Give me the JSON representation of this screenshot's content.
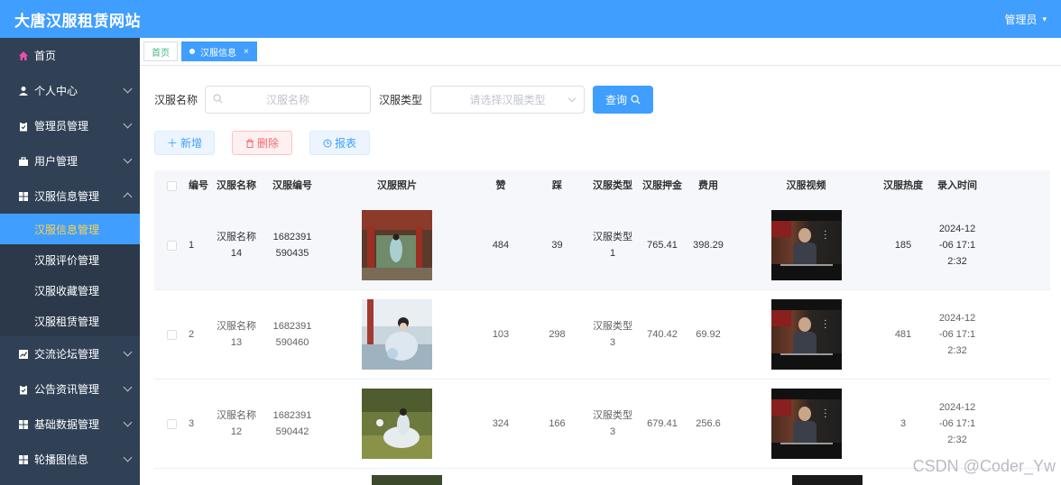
{
  "header": {
    "title": "大唐汉服租赁网站",
    "user_label": "管理员"
  },
  "sidebar": {
    "items": [
      {
        "label": "首页",
        "icon": "home-icon"
      },
      {
        "label": "个人中心",
        "icon": "user-icon"
      },
      {
        "label": "管理员管理",
        "icon": "clipboard-icon"
      },
      {
        "label": "用户管理",
        "icon": "briefcase-icon"
      },
      {
        "label": "汉服信息管理",
        "icon": "grid-icon"
      },
      {
        "label": "交流论坛管理",
        "icon": "chart-icon"
      },
      {
        "label": "公告资讯管理",
        "icon": "clipboard-icon"
      },
      {
        "label": "基础数据管理",
        "icon": "grid-icon"
      },
      {
        "label": "轮播图信息",
        "icon": "grid-icon"
      }
    ],
    "submenu": [
      {
        "label": "汉服信息管理",
        "active": true
      },
      {
        "label": "汉服评价管理"
      },
      {
        "label": "汉服收藏管理"
      },
      {
        "label": "汉服租赁管理"
      }
    ]
  },
  "tabs": [
    {
      "label": "首页"
    },
    {
      "label": "汉服信息",
      "close": "×"
    }
  ],
  "search": {
    "name_label": "汉服名称",
    "name_placeholder": "汉服名称",
    "type_label": "汉服类型",
    "type_placeholder": "请选择汉服类型",
    "query_button": "查询"
  },
  "actions": {
    "add": "新增",
    "delete": "删除",
    "report": "报表"
  },
  "table": {
    "columns": [
      "编号",
      "汉服名称",
      "汉服编号",
      "汉服照片",
      "赞",
      "踩",
      "汉服类型",
      "汉服押金",
      "费用",
      "汉服视频",
      "汉服热度",
      "录入时间"
    ],
    "rows": [
      {
        "no": "1",
        "name": "汉服名称\n14",
        "code": "1682391\n590435",
        "zan": "484",
        "cai": "39",
        "type": "汉服类型\n1",
        "deposit": "765.41",
        "fee": "398.29",
        "hot": "185",
        "time": "2024-12\n-06 17:1\n2:32"
      },
      {
        "no": "2",
        "name": "汉服名称\n13",
        "code": "1682391\n590460",
        "zan": "103",
        "cai": "298",
        "type": "汉服类型\n3",
        "deposit": "740.42",
        "fee": "69.92",
        "hot": "481",
        "time": "2024-12\n-06 17:1\n2:32"
      },
      {
        "no": "3",
        "name": "汉服名称\n12",
        "code": "1682391\n590442",
        "zan": "324",
        "cai": "166",
        "type": "汉服类型\n3",
        "deposit": "679.41",
        "fee": "256.6",
        "hot": "3",
        "time": "2024-12\n-06 17:1\n2:32"
      }
    ]
  },
  "watermark": "CSDN @Coder_Yw",
  "colors": {
    "header": "#409eff",
    "sidebar": "#304156",
    "active_sub_text": "#ffd04b"
  }
}
